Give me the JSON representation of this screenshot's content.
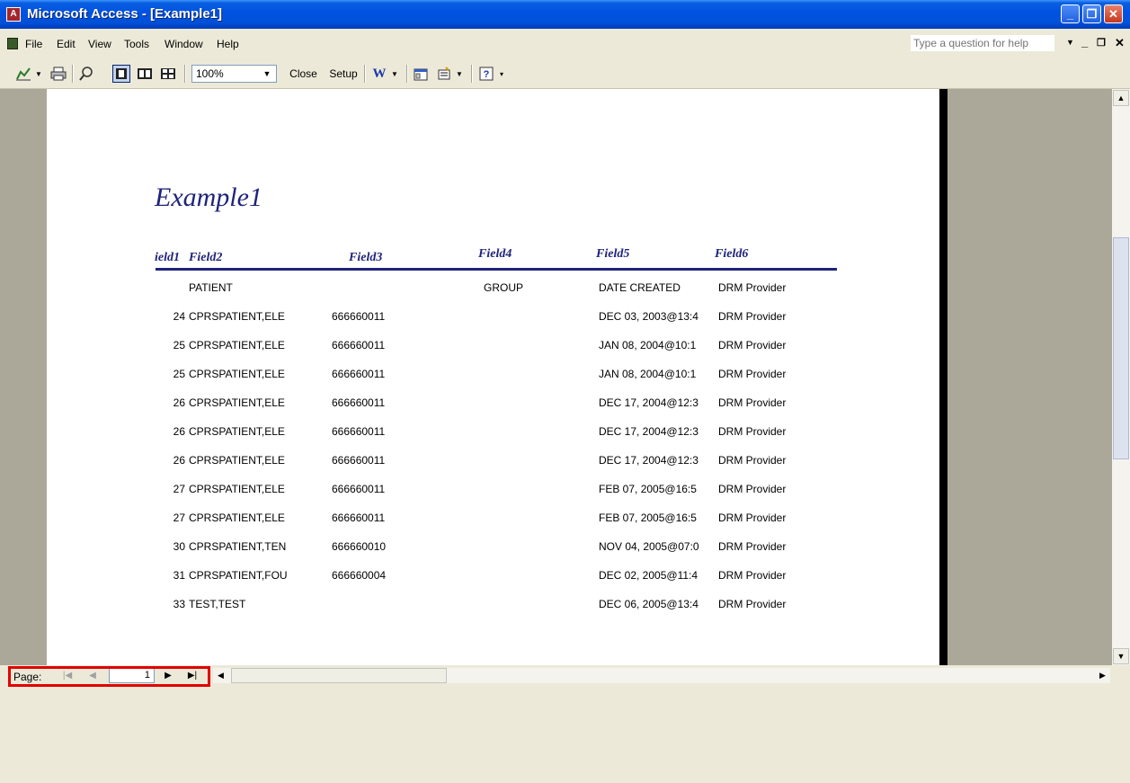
{
  "window": {
    "title": "Microsoft Access - [Example1]",
    "buttons": {
      "minimize": "_",
      "restore": "❐",
      "close": "✕"
    }
  },
  "menu": {
    "items": [
      "File",
      "Edit",
      "View",
      "Tools",
      "Window",
      "Help"
    ],
    "help_placeholder": "Type a question for help"
  },
  "toolbar": {
    "zoom": "100%",
    "close_label": "Close",
    "setup_label": "Setup"
  },
  "report": {
    "title": "Example1",
    "headers": [
      "ield1",
      "Field2",
      "Field3",
      "Field4",
      "Field5",
      "Field6"
    ],
    "rows": [
      {
        "f1": "",
        "f2": "PATIENT",
        "f3": "",
        "f4": "GROUP",
        "f5": "DATE CREATED",
        "f6": "DRM Provider"
      },
      {
        "f1": "24",
        "f2": "CPRSPATIENT,ELE",
        "f3": "666660011",
        "f4": "",
        "f5": "DEC 03, 2003@13:4",
        "f6": "DRM Provider"
      },
      {
        "f1": "25",
        "f2": "CPRSPATIENT,ELE",
        "f3": "666660011",
        "f4": "",
        "f5": "JAN 08, 2004@10:1",
        "f6": "DRM Provider"
      },
      {
        "f1": "25",
        "f2": "CPRSPATIENT,ELE",
        "f3": "666660011",
        "f4": "",
        "f5": "JAN 08, 2004@10:1",
        "f6": "DRM Provider"
      },
      {
        "f1": "26",
        "f2": "CPRSPATIENT,ELE",
        "f3": "666660011",
        "f4": "",
        "f5": "DEC 17, 2004@12:3",
        "f6": "DRM Provider"
      },
      {
        "f1": "26",
        "f2": "CPRSPATIENT,ELE",
        "f3": "666660011",
        "f4": "",
        "f5": "DEC 17, 2004@12:3",
        "f6": "DRM Provider"
      },
      {
        "f1": "26",
        "f2": "CPRSPATIENT,ELE",
        "f3": "666660011",
        "f4": "",
        "f5": "DEC 17, 2004@12:3",
        "f6": "DRM Provider"
      },
      {
        "f1": "27",
        "f2": "CPRSPATIENT,ELE",
        "f3": "666660011",
        "f4": "",
        "f5": "FEB 07, 2005@16:5",
        "f6": "DRM Provider"
      },
      {
        "f1": "27",
        "f2": "CPRSPATIENT,ELE",
        "f3": "666660011",
        "f4": "",
        "f5": "FEB 07, 2005@16:5",
        "f6": "DRM Provider"
      },
      {
        "f1": "30",
        "f2": "CPRSPATIENT,TEN",
        "f3": "666660010",
        "f4": "",
        "f5": "NOV 04, 2005@07:0",
        "f6": "DRM Provider"
      },
      {
        "f1": "31",
        "f2": "CPRSPATIENT,FOU",
        "f3": "666660004",
        "f4": "",
        "f5": "DEC 02, 2005@11:4",
        "f6": "DRM Provider"
      },
      {
        "f1": "33",
        "f2": "TEST,TEST",
        "f3": "",
        "f4": "",
        "f5": "DEC 06, 2005@13:4",
        "f6": "DRM Provider"
      }
    ]
  },
  "navigation": {
    "page_label": "Page:",
    "current_page": "1"
  }
}
